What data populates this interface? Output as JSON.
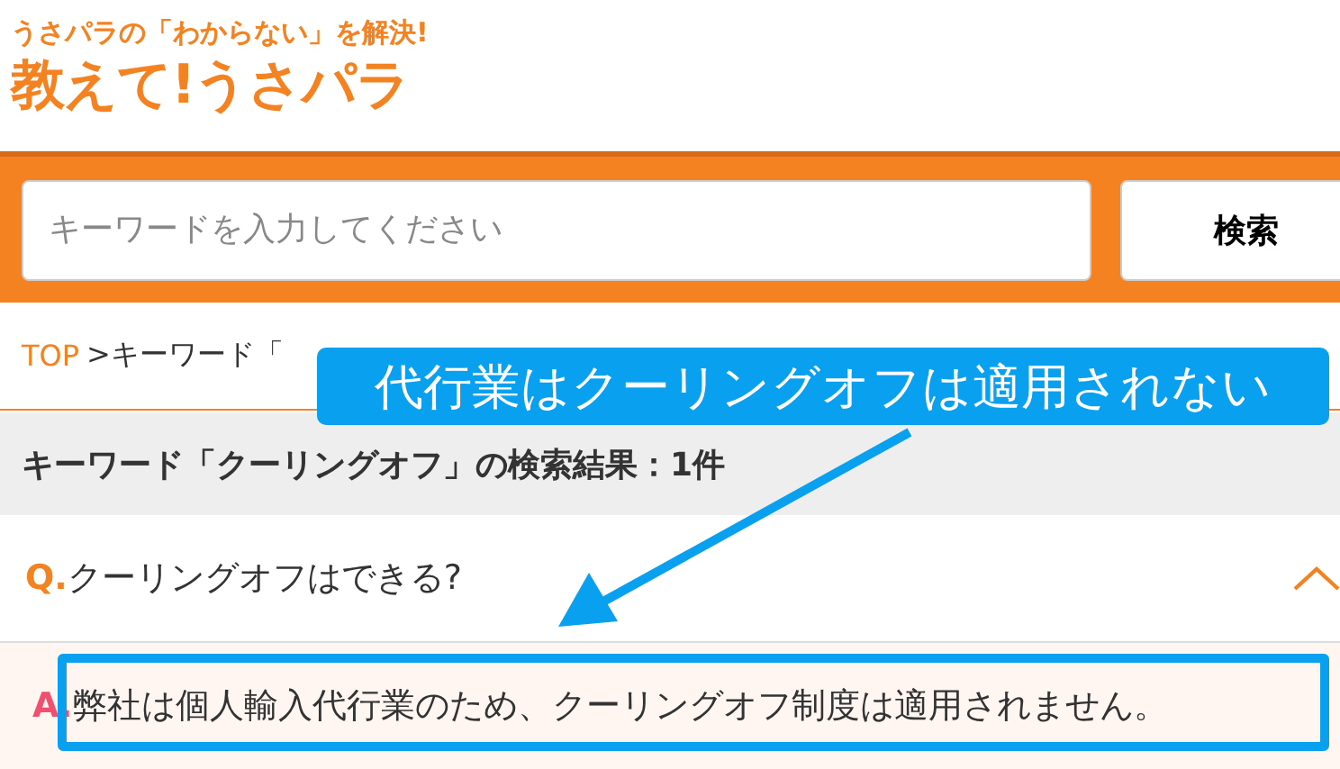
{
  "header": {
    "tagline": "うさパラの「わからない」を解決!",
    "logo": "教えて!うさパラ"
  },
  "search": {
    "placeholder": "キーワードを入力してください",
    "button": "検索"
  },
  "breadcrumb": {
    "home": "TOP",
    "current": ">キーワード「"
  },
  "results_heading": "キーワード「クーリングオフ」の検索結果：1件",
  "faq": [
    {
      "q_mark": "Q.",
      "question": "クーリングオフはできる?",
      "expanded": true,
      "a_mark": "A.",
      "answer": "弊社は個人輸入代行業のため、クーリングオフ制度は適用されません。"
    }
  ],
  "annotation": {
    "callout": "代行業はクーリングオフは適用されない"
  }
}
